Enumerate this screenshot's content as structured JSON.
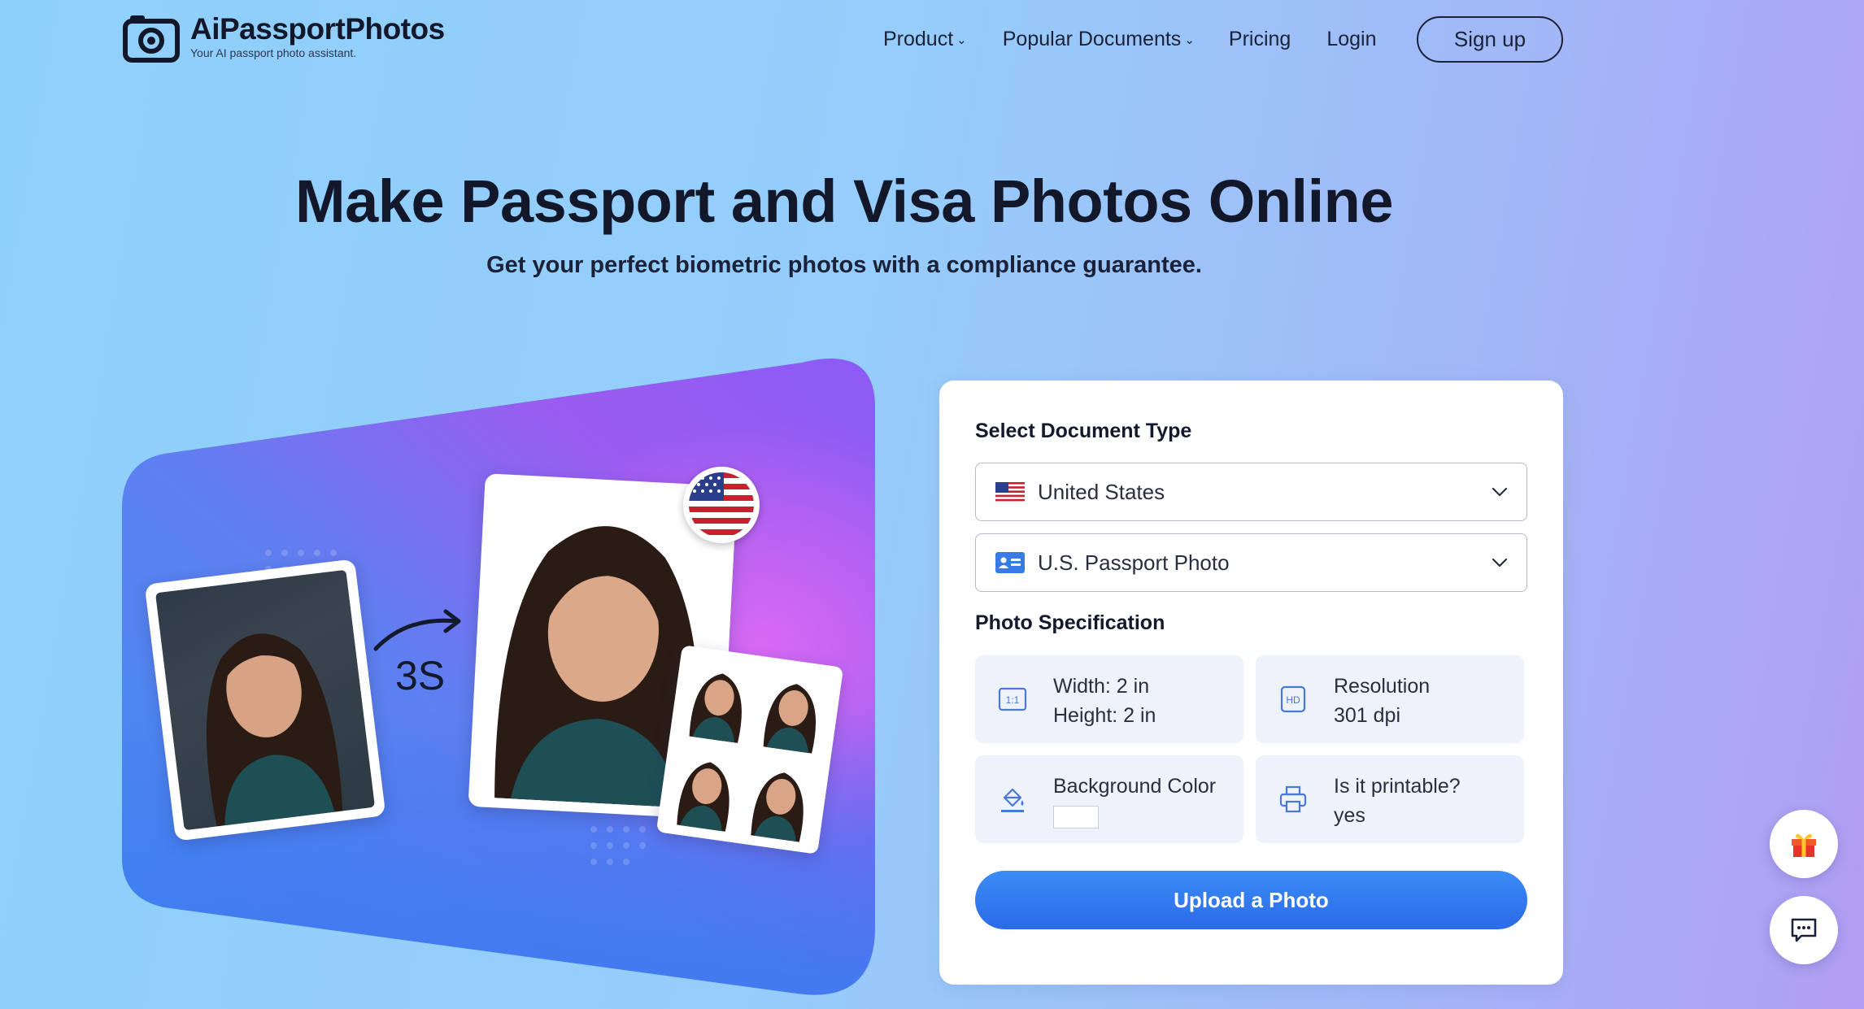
{
  "brand": {
    "name": "AiPassportPhotos",
    "tagline": "Your AI passport photo assistant."
  },
  "nav": {
    "items": [
      {
        "label": "Product",
        "has_dropdown": true
      },
      {
        "label": "Popular Documents",
        "has_dropdown": true
      },
      {
        "label": "Pricing",
        "has_dropdown": false
      },
      {
        "label": "Login",
        "has_dropdown": false
      }
    ],
    "signup_label": "Sign up",
    "caret_glyph": "⌄"
  },
  "hero": {
    "title": "Make Passport and Visa Photos Online",
    "subtitle": "Get your perfect biometric photos with a compliance guarantee."
  },
  "illustration": {
    "time_label": "3S"
  },
  "form": {
    "document_heading": "Select Document Type",
    "country_select": {
      "value": "United States",
      "icon": "us-flag-icon"
    },
    "document_select": {
      "value": "U.S. Passport Photo",
      "icon": "id-card-icon"
    },
    "spec_heading": "Photo Specification",
    "specs": {
      "size": {
        "line1": "Width: 2 in",
        "line2": "Height: 2 in",
        "icon": "aspect-ratio-icon"
      },
      "resolution": {
        "line1": "Resolution",
        "line2": "301 dpi",
        "icon": "hd-icon"
      },
      "background": {
        "line1": "Background Color",
        "swatch_color": "#ffffff",
        "icon": "paint-bucket-icon"
      },
      "printable": {
        "line1": "Is it printable?",
        "line2": "yes",
        "icon": "printer-icon"
      }
    },
    "upload_label": "Upload a Photo"
  },
  "floating": {
    "gift_icon": "gift-icon",
    "chat_icon": "chat-icon"
  },
  "colors": {
    "accent": "#2b6ae8",
    "text_dark": "#141a2e",
    "panel_tile": "#eef3fb"
  }
}
